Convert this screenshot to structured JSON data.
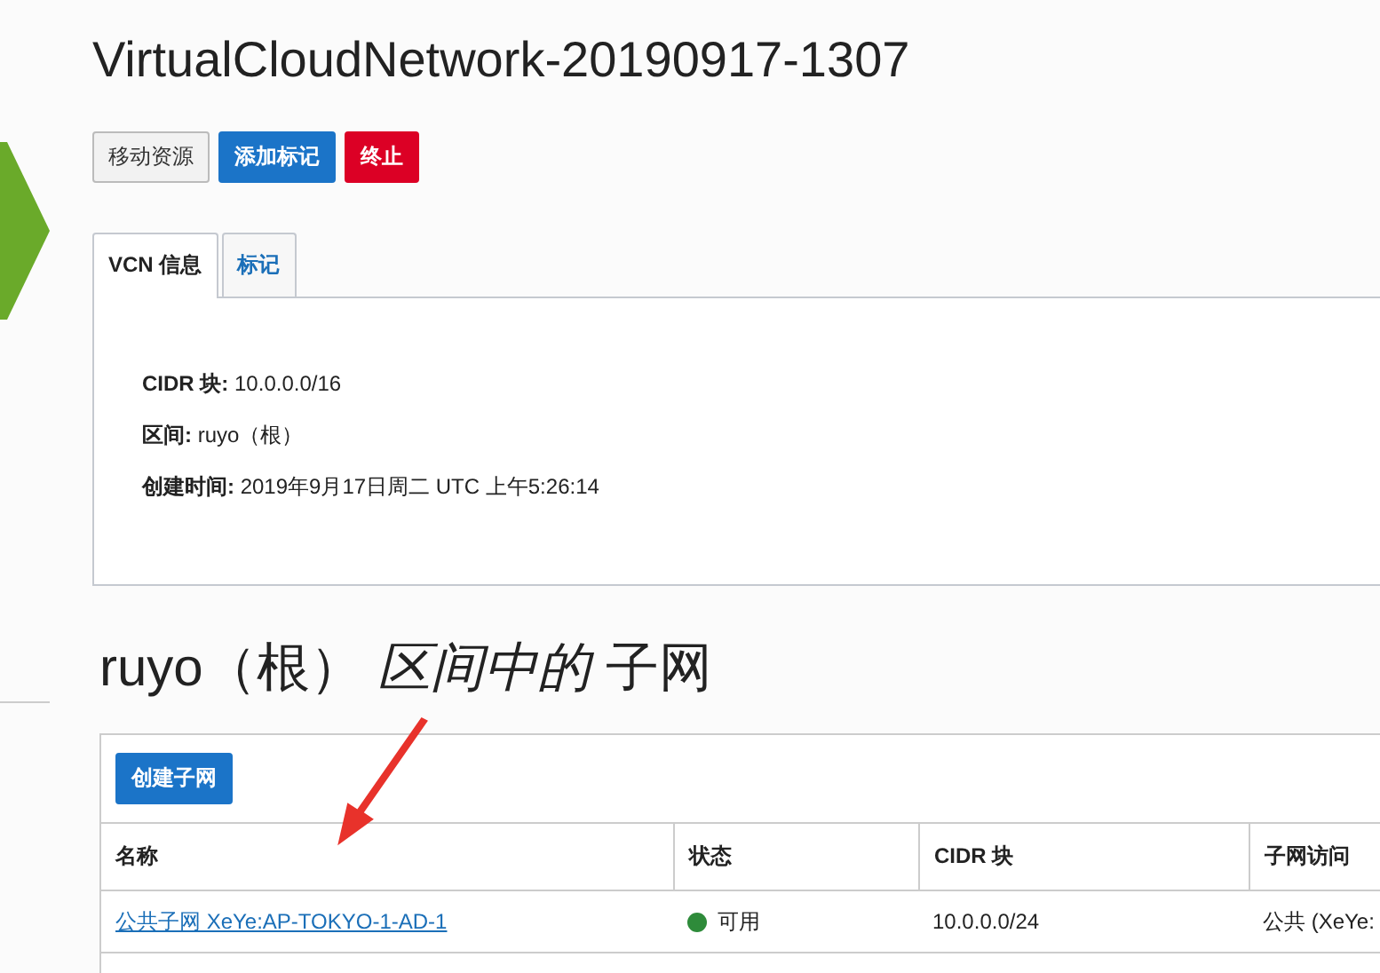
{
  "title": "VirtualCloudNetwork-20190917-1307",
  "actions": [
    {
      "label": "移动资源",
      "kind": "default"
    },
    {
      "label": "添加标记",
      "kind": "primary"
    },
    {
      "label": "终止",
      "kind": "danger"
    }
  ],
  "tabs": [
    {
      "label": "VCN 信息",
      "selected": true
    },
    {
      "label": "标记",
      "selected": false
    }
  ],
  "details": [
    {
      "label": "CIDR 块:",
      "value": "10.0.0.0/16"
    },
    {
      "label": "区间:",
      "value": "ruyo（根）"
    },
    {
      "label": "创建时间:",
      "value": "2019年9月17日周二 UTC 上午5:26:14"
    }
  ],
  "subnets_heading": "ruyo（根） *区间中的* 子网",
  "create_button": "创建子网",
  "table": {
    "columns": [
      "名称",
      "状态",
      "CIDR 块",
      "子网访问"
    ],
    "rows": [
      {
        "name": "公共子网 XeYe:AP-TOKYO-1-AD-1",
        "status": "可用",
        "color": "#2e8b3a",
        "cidr": "10.0.0.0/24",
        "access": "公共 (XeYe:"
      }
    ]
  }
}
